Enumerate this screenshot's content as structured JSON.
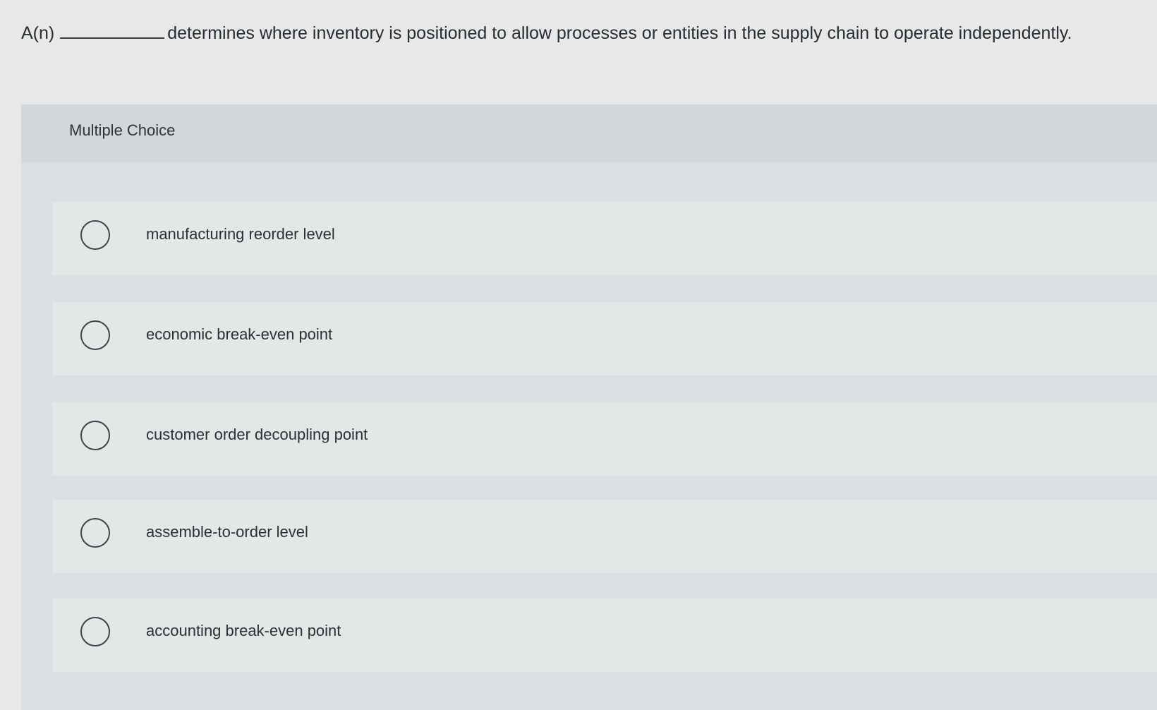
{
  "question": {
    "prefix": "A(n)",
    "suffix": "determines where inventory is positioned to allow processes or entities in the supply chain to operate independently."
  },
  "panel": {
    "title": "Multiple Choice"
  },
  "choices": [
    {
      "label": "manufacturing reorder level",
      "selected": false
    },
    {
      "label": "economic break-even point",
      "selected": false
    },
    {
      "label": "customer order decoupling point",
      "selected": false
    },
    {
      "label": "assemble-to-order level",
      "selected": false
    },
    {
      "label": "accounting break-even point",
      "selected": false
    }
  ]
}
